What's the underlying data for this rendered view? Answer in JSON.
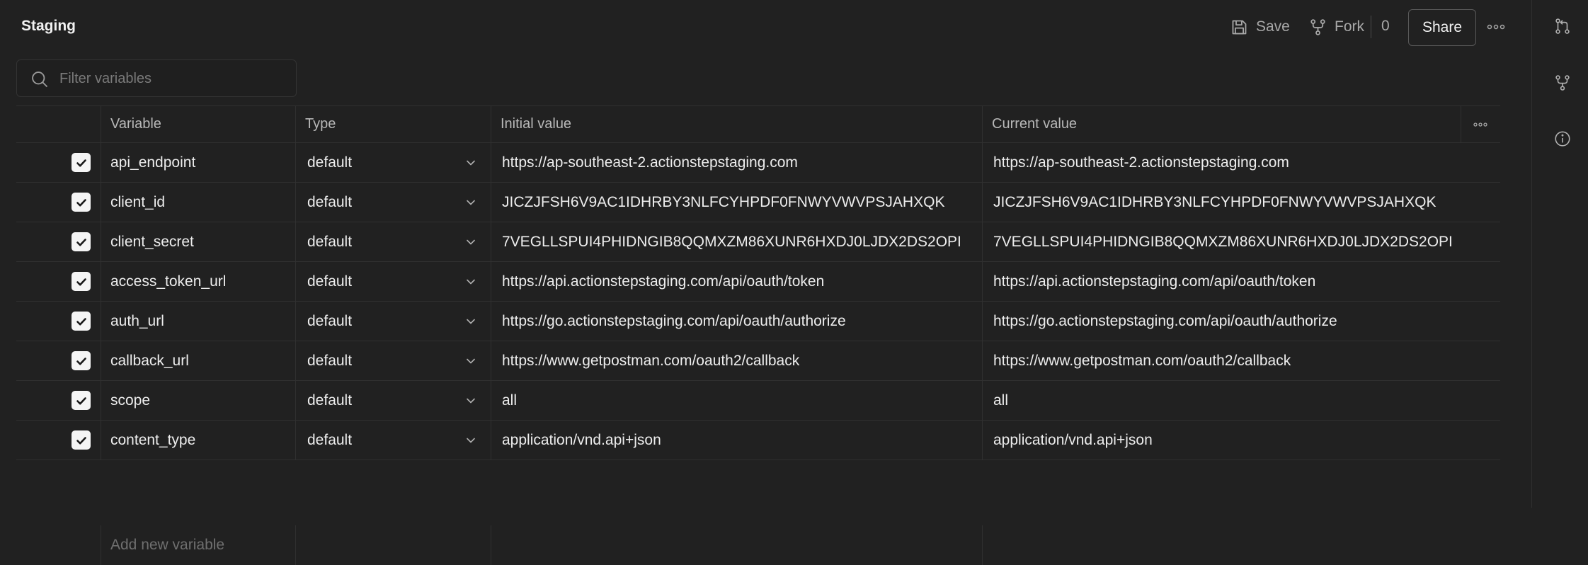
{
  "header": {
    "title": "Staging",
    "save_label": "Save",
    "fork_label": "Fork",
    "fork_count": "0",
    "share_label": "Share"
  },
  "filter": {
    "placeholder": "Filter variables"
  },
  "table": {
    "columns": [
      "Variable",
      "Type",
      "Initial value",
      "Current value"
    ],
    "rows": [
      {
        "checked": true,
        "variable": "api_endpoint",
        "type": "default",
        "initial": "https://ap-southeast-2.actionstepstaging.com",
        "current": "https://ap-southeast-2.actionstepstaging.com"
      },
      {
        "checked": true,
        "variable": "client_id",
        "type": "default",
        "initial": "JICZJFSH6V9AC1IDHRBY3NLFCYHPDF0FNWYVWVPSJAHXQK",
        "current": "JICZJFSH6V9AC1IDHRBY3NLFCYHPDF0FNWYVWVPSJAHXQK"
      },
      {
        "checked": true,
        "variable": "client_secret",
        "type": "default",
        "initial": "7VEGLLSPUI4PHIDNGIB8QQMXZM86XUNR6HXDJ0LJDX2DS2OPI",
        "current": "7VEGLLSPUI4PHIDNGIB8QQMXZM86XUNR6HXDJ0LJDX2DS2OPI"
      },
      {
        "checked": true,
        "variable": "access_token_url",
        "type": "default",
        "initial": "https://api.actionstepstaging.com/api/oauth/token",
        "current": "https://api.actionstepstaging.com/api/oauth/token"
      },
      {
        "checked": true,
        "variable": "auth_url",
        "type": "default",
        "initial": "https://go.actionstepstaging.com/api/oauth/authorize",
        "current": "https://go.actionstepstaging.com/api/oauth/authorize"
      },
      {
        "checked": true,
        "variable": "callback_url",
        "type": "default",
        "initial": "https://www.getpostman.com/oauth2/callback",
        "current": "https://www.getpostman.com/oauth2/callback"
      },
      {
        "checked": true,
        "variable": "scope",
        "type": "default",
        "initial": "all",
        "current": "all"
      },
      {
        "checked": true,
        "variable": "content_type",
        "type": "default",
        "initial": "application/vnd.api+json",
        "current": "application/vnd.api+json"
      }
    ],
    "add_placeholder": "Add new variable"
  },
  "icons": {
    "save": "save-icon",
    "fork": "fork-icon",
    "more": "more-horizontal-icon",
    "search": "search-icon",
    "pull_request": "pull-request-icon",
    "fork_sidebar": "fork-icon",
    "info": "info-icon"
  },
  "colors": {
    "background": "#212121",
    "border": "#303030",
    "checkbox": "#f5f5f5"
  }
}
